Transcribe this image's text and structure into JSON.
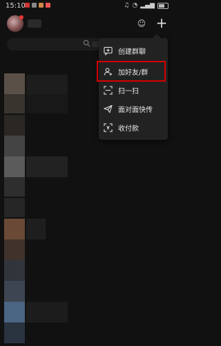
{
  "status_bar": {
    "time": "15:10"
  },
  "header": {
    "avatar": "avatar",
    "add_icon": "plus-icon"
  },
  "search": {
    "icon": "search-icon"
  },
  "menu": {
    "items": [
      {
        "label": "创建群聊",
        "icon": "chat-add-icon"
      },
      {
        "label": "加好友/群",
        "icon": "add-friend-icon"
      },
      {
        "label": "扫一扫",
        "icon": "scan-icon"
      },
      {
        "label": "面对面快传",
        "icon": "send-icon"
      },
      {
        "label": "收付款",
        "icon": "payment-icon"
      }
    ]
  },
  "colors": {
    "background": "#111111",
    "menu": "#222222",
    "highlight": "#d80000"
  }
}
